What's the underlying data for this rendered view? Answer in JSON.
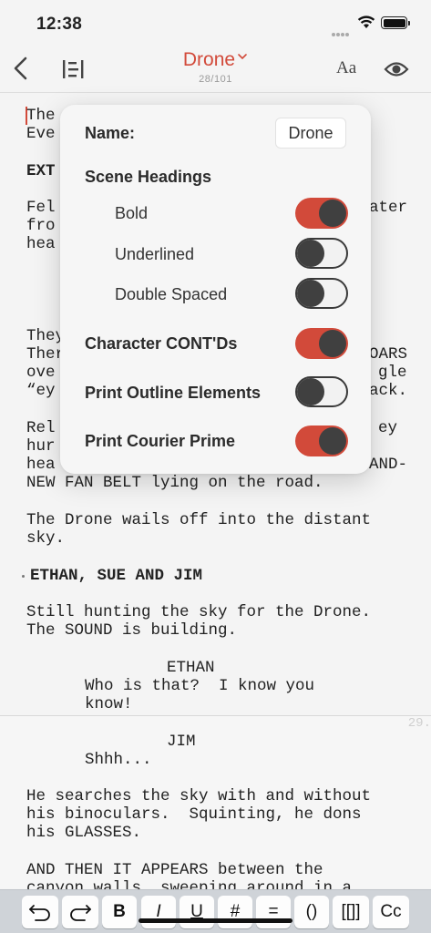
{
  "status": {
    "time": "12:38"
  },
  "nav": {
    "title": "Drone",
    "page_counter": "28/101",
    "font_button": "Aa"
  },
  "popover": {
    "name_label": "Name:",
    "name_value": "Drone",
    "scene_headings_label": "Scene Headings",
    "options": [
      {
        "label": "Bold",
        "on": true
      },
      {
        "label": "Underlined",
        "on": false
      },
      {
        "label": "Double Spaced",
        "on": false
      },
      {
        "label": "Character CONT'Ds",
        "on": true
      },
      {
        "label": "Print Outline Elements",
        "on": false
      },
      {
        "label": "Print Courier Prime",
        "on": true
      }
    ]
  },
  "script": {
    "lines": [
      "The",
      "Eve",
      "EXT",
      "Fel",
      "fro",
      "hea",
      "They",
      "Ther",
      "ove",
      "“ey",
      "Rel",
      "hur",
      "hea",
      "ater",
      "OARS",
      "gle",
      "ack.",
      "ey",
      "AND-",
      "NEW FAN BELT lying on the road.",
      "The Drone wails off into the distant",
      "sky.",
      "ETHAN, SUE AND JIM",
      "Still hunting the sky for the Drone.",
      "The SOUND is building.",
      "ETHAN",
      "Who is that?  I know you",
      "know!",
      "JIM",
      "Shhh...",
      "He searches the sky with and without",
      "his binoculars.  Squinting, he dons",
      "his GLASSES.",
      "AND THEN IT APPEARS between the",
      "canyon walls, sweeping around in a"
    ],
    "page_number": "29."
  },
  "toolbar": {
    "undo": "undo-icon",
    "redo": "redo-icon",
    "bold": "B",
    "italic": "I",
    "underline": "U",
    "hash": "#",
    "equals": "=",
    "parens": "()",
    "brackets": "[[]]",
    "cc": "Cc"
  }
}
